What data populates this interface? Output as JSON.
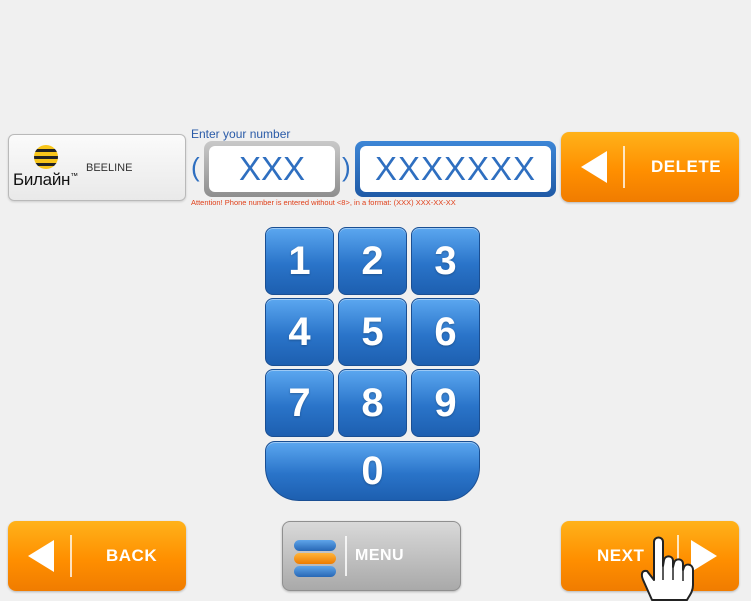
{
  "operator": {
    "logo_text": "Билайн",
    "logo_tm": "™",
    "name": "BEELINE"
  },
  "phone": {
    "label": "Enter your number",
    "open_paren": "(",
    "close_paren": ")",
    "code_value": "XXX",
    "number_value": "XXXXXXX",
    "attention": "Attention! Phone number is entered without <8>, in a format: (XXX) XXX-XX-XX"
  },
  "keypad": {
    "keys": [
      "1",
      "2",
      "3",
      "4",
      "5",
      "6",
      "7",
      "8",
      "9",
      "0"
    ]
  },
  "buttons": {
    "delete": "DELETE",
    "back": "BACK",
    "menu": "MENU",
    "next": "NEXT"
  },
  "colors": {
    "accent_orange": "#ff8f00",
    "accent_blue": "#2a74c9",
    "text_blue": "#2f6fc0",
    "warning_red": "#e0401a"
  },
  "icons": {
    "beeline_logo": "beeline-logo-icon",
    "delete_arrow": "arrow-left-icon",
    "back_arrow": "arrow-left-icon",
    "next_arrow": "arrow-right-icon",
    "menu_icon": "stack-icon",
    "cursor": "hand-pointer-icon"
  }
}
